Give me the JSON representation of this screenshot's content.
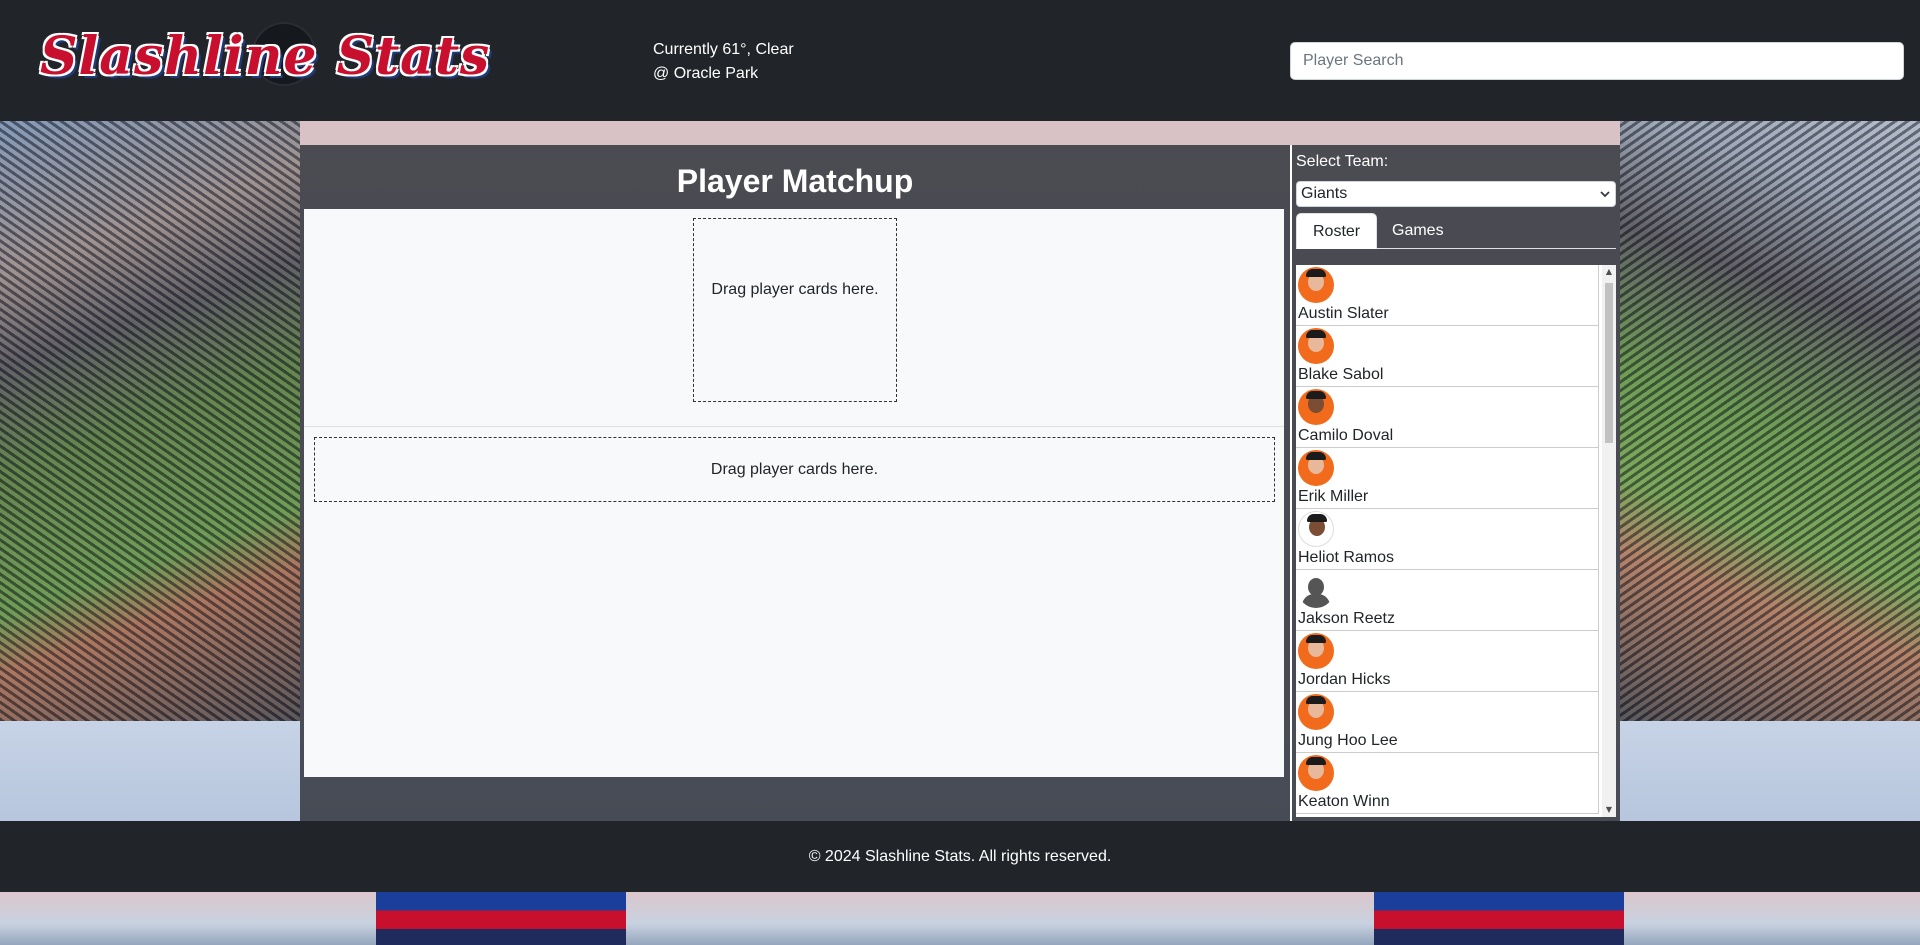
{
  "header": {
    "logo_text": "Slashline Stats",
    "weather_line1": "Currently 61°, Clear",
    "weather_line2": "@ Oracle Park",
    "search_placeholder": "Player Search"
  },
  "matchup": {
    "title": "Player Matchup",
    "drop_top": "Drag player cards here.",
    "drop_bottom": "Drag player cards here."
  },
  "side": {
    "select_label": "Select Team:",
    "selected_team": "Giants",
    "tabs": [
      {
        "label": "Roster",
        "active": true
      },
      {
        "label": "Games",
        "active": false
      }
    ],
    "players": [
      {
        "name": "Austin Slater",
        "avatar": "player-headshot-icon"
      },
      {
        "name": "Blake Sabol",
        "avatar": "player-headshot-icon"
      },
      {
        "name": "Camilo Doval",
        "avatar": "player-headshot-icon"
      },
      {
        "name": "Erik Miller",
        "avatar": "player-headshot-icon"
      },
      {
        "name": "Heliot Ramos",
        "avatar": "player-headshot-icon"
      },
      {
        "name": "Jakson Reetz",
        "avatar": "placeholder-avatar-icon"
      },
      {
        "name": "Jordan Hicks",
        "avatar": "player-headshot-icon"
      },
      {
        "name": "Jung Hoo Lee",
        "avatar": "player-headshot-icon"
      },
      {
        "name": "Keaton Winn",
        "avatar": "player-headshot-icon"
      }
    ]
  },
  "footer": {
    "text": "© 2024 Slashline Stats. All rights reserved."
  },
  "colors": {
    "header_bg": "#212529",
    "panel_bg": "#373a42",
    "giants_orange": "#f26b1d"
  }
}
